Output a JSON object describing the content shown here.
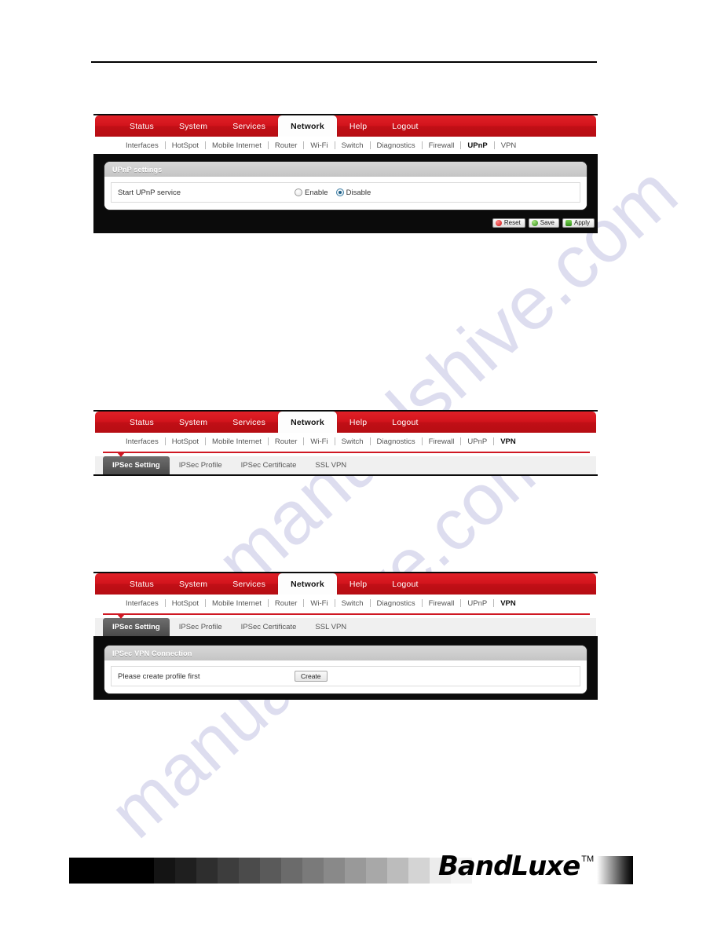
{
  "watermark": {
    "line1": "manualshive.com",
    "line2": "manualshive.com"
  },
  "colors": {
    "brand_red": "#cf1823",
    "nav_red": "#d2141c",
    "panel_dark": "#0b0b0b",
    "card_head_gray": "#c4c4c4",
    "active_tab_gray": "#4a4a4a"
  },
  "main_nav": [
    {
      "label": "Status",
      "active": false
    },
    {
      "label": "System",
      "active": false
    },
    {
      "label": "Services",
      "active": false
    },
    {
      "label": "Network",
      "active": true
    },
    {
      "label": "Help",
      "active": false
    },
    {
      "label": "Logout",
      "active": false
    }
  ],
  "sub_nav_upnp": [
    {
      "label": "Interfaces",
      "active": false
    },
    {
      "label": "HotSpot",
      "active": false
    },
    {
      "label": "Mobile Internet",
      "active": false
    },
    {
      "label": "Router",
      "active": false
    },
    {
      "label": "Wi-Fi",
      "active": false
    },
    {
      "label": "Switch",
      "active": false
    },
    {
      "label": "Diagnostics",
      "active": false
    },
    {
      "label": "Firewall",
      "active": false
    },
    {
      "label": "UPnP",
      "active": true
    },
    {
      "label": "VPN",
      "active": false
    }
  ],
  "sub_nav_vpn": [
    {
      "label": "Interfaces",
      "active": false
    },
    {
      "label": "HotSpot",
      "active": false
    },
    {
      "label": "Mobile Internet",
      "active": false
    },
    {
      "label": "Router",
      "active": false
    },
    {
      "label": "Wi-Fi",
      "active": false
    },
    {
      "label": "Switch",
      "active": false
    },
    {
      "label": "Diagnostics",
      "active": false
    },
    {
      "label": "Firewall",
      "active": false
    },
    {
      "label": "UPnP",
      "active": false
    },
    {
      "label": "VPN",
      "active": true
    }
  ],
  "ipsec_tabs": [
    {
      "label": "IPSec Setting",
      "active": true
    },
    {
      "label": "IPSec Profile",
      "active": false
    },
    {
      "label": "IPSec Certificate",
      "active": false
    },
    {
      "label": "SSL VPN",
      "active": false
    }
  ],
  "upnp_panel": {
    "card_title": "UPnP settings",
    "field_label": "Start UPnP service",
    "options": [
      {
        "label": "Enable",
        "selected": false
      },
      {
        "label": "Disable",
        "selected": true
      }
    ]
  },
  "action_buttons": [
    {
      "label": "Reset",
      "icon": "reset-icon"
    },
    {
      "label": "Save",
      "icon": "save-icon"
    },
    {
      "label": "Apply",
      "icon": "apply-icon"
    }
  ],
  "vpn_panel": {
    "card_title_prefix": "IPSec",
    "card_title": "IPSec VPN Connection",
    "message": "Please create profile first",
    "create_button": "Create"
  },
  "footer": {
    "logo_text": "BandLuxe",
    "trademark": "TM",
    "grayscale_steps": [
      "#000000",
      "#000000",
      "#000000",
      "#000000",
      "#141414",
      "#1f1f1f",
      "#2e2e2e",
      "#3d3d3d",
      "#4b4b4b",
      "#5a5a5a",
      "#6b6b6b",
      "#7a7a7a",
      "#898989",
      "#999999",
      "#a8a8a8",
      "#bcbcbc",
      "#d4d4d4",
      "#ececec",
      "#f4f4f4"
    ]
  }
}
